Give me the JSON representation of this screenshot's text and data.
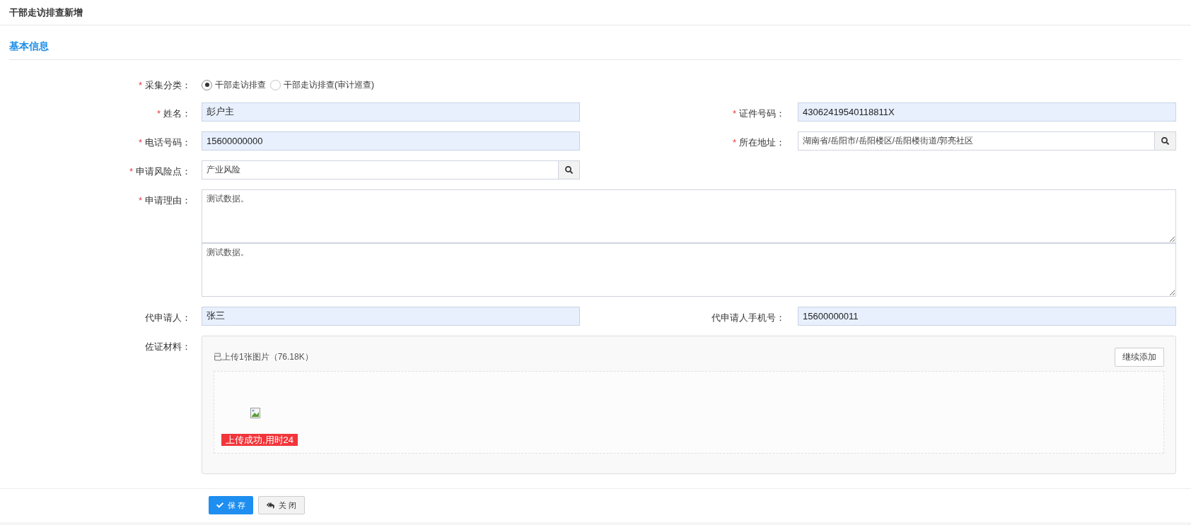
{
  "page_title": "干部走访排查新增",
  "section_title": "基本信息",
  "category": {
    "label": "采集分类：",
    "marker": "*",
    "options": [
      {
        "label": "干部走访排查",
        "selected": true
      },
      {
        "label": "干部走访排查(审计巡查)",
        "selected": false
      }
    ]
  },
  "rows": [
    [
      {
        "kind": "text",
        "label": "姓名：",
        "marker": "*",
        "value": "彭户主"
      },
      {
        "kind": "text",
        "label": "证件号码：",
        "marker": "*",
        "value": "43062419540118811X"
      }
    ],
    [
      {
        "kind": "text",
        "label": "电话号码：",
        "marker": "*",
        "value": "15600000000"
      },
      {
        "kind": "lookup",
        "label": "所在地址：",
        "marker": "*",
        "value": "湖南省/岳阳市/岳阳楼区/岳阳楼街道/郭亮社区"
      }
    ],
    [
      {
        "kind": "lookup",
        "label": "申请风险点：",
        "marker": "*",
        "value": "产业风险"
      }
    ],
    [
      {
        "kind": "textarea",
        "label": "申请理由：",
        "marker": "*",
        "boxes": [
          "测试数据。",
          "测试数据。"
        ]
      }
    ],
    [
      {
        "kind": "text",
        "label": "代申请人：",
        "value": "张三"
      },
      {
        "kind": "text",
        "label": "代申请人手机号：",
        "value": "15600000011"
      }
    ]
  ],
  "materials": {
    "label": "佐证材料：",
    "summary": "已上传1张图片（76.18K）",
    "add_button": "继续添加",
    "status": "上传成功,用时24"
  },
  "buttons": [
    {
      "kind": "primary",
      "label": "保 存"
    },
    {
      "kind": "default",
      "label": "关 闭"
    }
  ]
}
